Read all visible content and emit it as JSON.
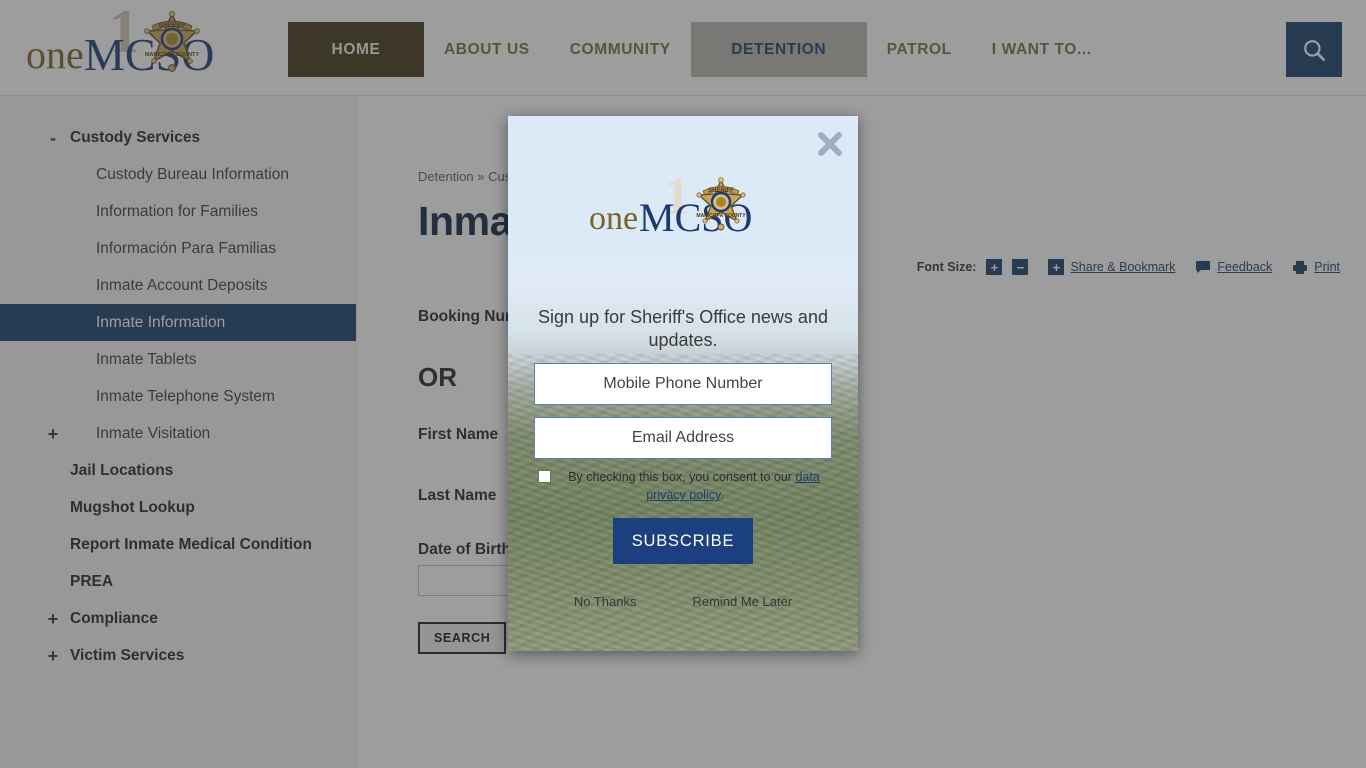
{
  "header": {
    "logo_alt": "oneMCSO Maricopa County Sheriff",
    "nav": [
      {
        "label": "HOME",
        "state": "active-home"
      },
      {
        "label": "ABOUT US",
        "state": "normal"
      },
      {
        "label": "COMMUNITY",
        "state": "normal"
      },
      {
        "label": "DETENTION",
        "state": "active-section"
      },
      {
        "label": "PATROL",
        "state": "normal"
      },
      {
        "label": "I WANT TO...",
        "state": "normal"
      }
    ],
    "search_icon": "search-icon"
  },
  "sidebar": {
    "items": [
      {
        "label": "Custody Services",
        "level": 1,
        "toggle": "-",
        "selected": false
      },
      {
        "label": "Custody Bureau Information",
        "level": 2,
        "toggle": "",
        "selected": false
      },
      {
        "label": "Information for Families",
        "level": 2,
        "toggle": "",
        "selected": false
      },
      {
        "label": "Información Para Familias",
        "level": 2,
        "toggle": "",
        "selected": false
      },
      {
        "label": "Inmate Account Deposits",
        "level": 2,
        "toggle": "",
        "selected": false
      },
      {
        "label": "Inmate Information",
        "level": 2,
        "toggle": "",
        "selected": true
      },
      {
        "label": "Inmate Tablets",
        "level": 2,
        "toggle": "",
        "selected": false
      },
      {
        "label": "Inmate Telephone System",
        "level": 2,
        "toggle": "",
        "selected": false
      },
      {
        "label": "Inmate Visitation",
        "level": 2,
        "toggle": "+",
        "selected": false
      },
      {
        "label": "Jail Locations",
        "level": 1,
        "toggle": "",
        "selected": false
      },
      {
        "label": "Mugshot Lookup",
        "level": 1,
        "toggle": "",
        "selected": false
      },
      {
        "label": "Report Inmate Medical Condition",
        "level": 1,
        "toggle": "",
        "selected": false
      },
      {
        "label": "PREA",
        "level": 1,
        "toggle": "",
        "selected": false
      },
      {
        "label": "Compliance",
        "level": 1,
        "toggle": "+",
        "selected": false
      },
      {
        "label": "Victim Services",
        "level": 1,
        "toggle": "+",
        "selected": false
      }
    ]
  },
  "main": {
    "breadcrumb": "Detention » Custody Services » Inmate Information",
    "title": "Inmate Information",
    "toolbar": {
      "font_size_label": "Font Size:",
      "increase": "+",
      "decrease": "−",
      "share_plus": "+",
      "share_label": "Share & Bookmark",
      "feedback_label": "Feedback",
      "print_label": "Print"
    },
    "form": {
      "booking_label": "Booking Number",
      "or_label": "OR",
      "first_name_label": "First Name",
      "last_name_label": "Last Name",
      "dob_label": "Date of Birth",
      "booking_value": "",
      "first_name_value": "",
      "last_name_value": "",
      "dob_value": "",
      "search_button": "SEARCH"
    }
  },
  "modal": {
    "close_icon": "close-icon",
    "logo_alt": "oneMCSO Maricopa County Sheriff",
    "headline": "Sign up for Sheriff's Office news and updates.",
    "phone_placeholder": "Mobile Phone Number",
    "phone_value": "",
    "email_placeholder": "Email Address",
    "email_value": "",
    "consent_prefix": "By checking this box, you consent to our ",
    "consent_link": "data privacy policy",
    "consent_suffix": ".",
    "subscribe_label": "SUBSCRIBE",
    "no_thanks_label": "No Thanks",
    "remind_label": "Remind Me Later"
  },
  "colors": {
    "brand_navy": "#123a6b",
    "brand_gold": "#7a6a3a",
    "home_tab": "#3e3212",
    "subscribe": "#1c3f7f",
    "overlay": "#3c3c3c"
  }
}
